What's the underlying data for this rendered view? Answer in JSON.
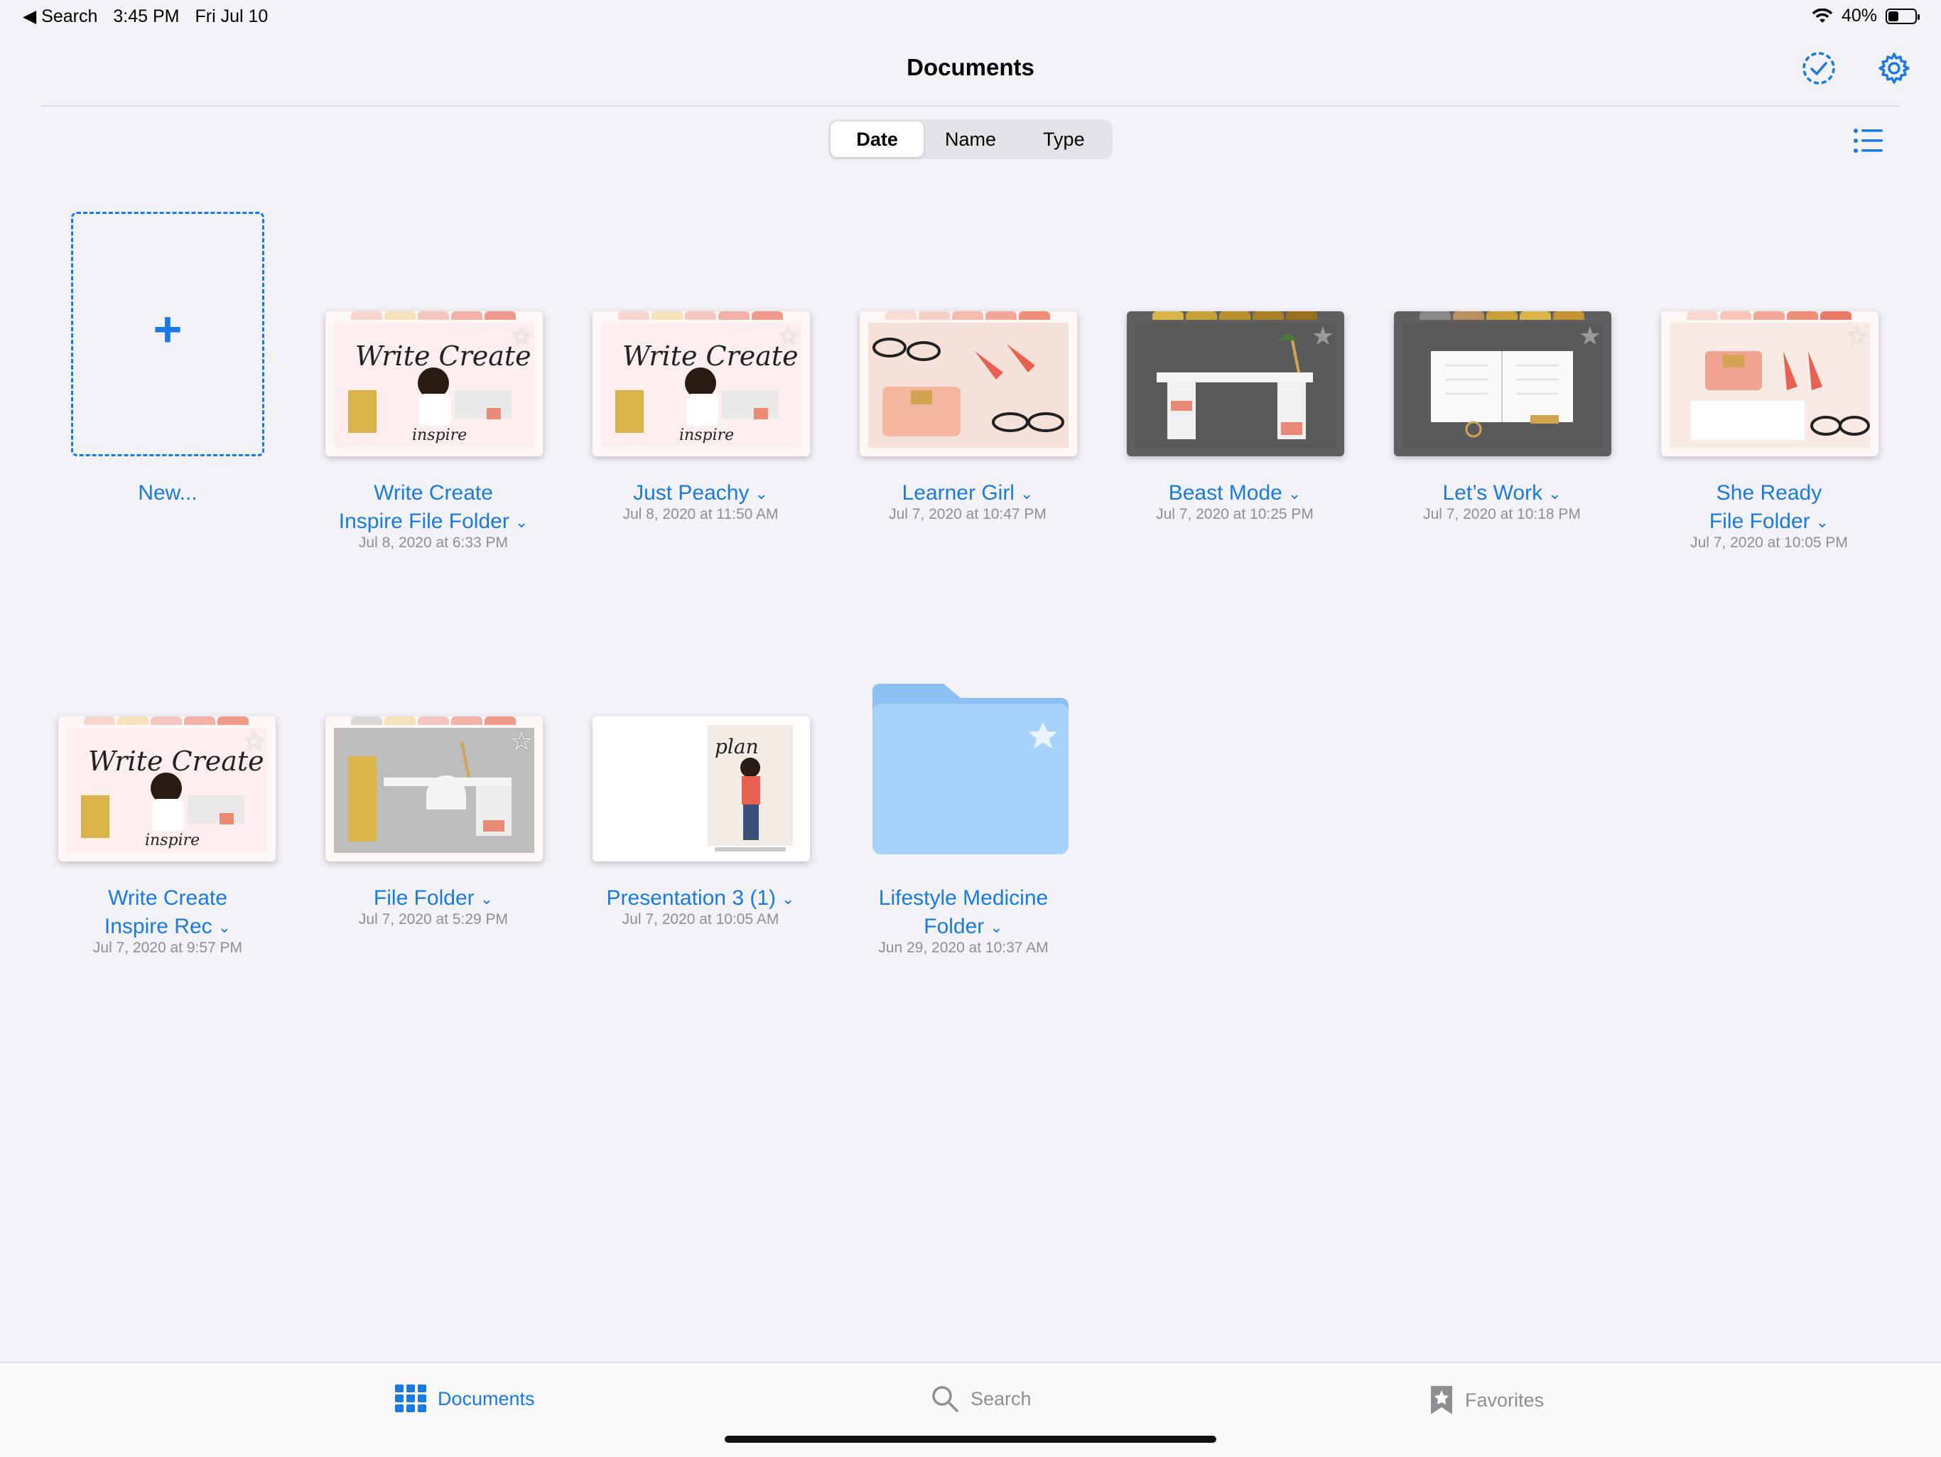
{
  "status": {
    "back_label": "Search",
    "time": "3:45 PM",
    "date": "Fri Jul 10",
    "battery": "40%",
    "battery_level": 0.4
  },
  "header": {
    "title": "Documents"
  },
  "sort": {
    "options": [
      "Date",
      "Name",
      "Type"
    ],
    "selected": "Date"
  },
  "new_item": {
    "label": "New..."
  },
  "documents": [
    {
      "name_lines": [
        "Write Create",
        "Inspire File Folder"
      ],
      "date": "Jul 8, 2020 at 6:33 PM"
    },
    {
      "name_lines": [
        "Just Peachy"
      ],
      "date": "Jul 8, 2020 at 11:50 AM"
    },
    {
      "name_lines": [
        "Learner Girl"
      ],
      "date": "Jul 7, 2020 at 10:47 PM"
    },
    {
      "name_lines": [
        "Beast Mode"
      ],
      "date": "Jul 7, 2020 at 10:25 PM"
    },
    {
      "name_lines": [
        "Let’s Work"
      ],
      "date": "Jul 7, 2020 at 10:18 PM"
    },
    {
      "name_lines": [
        "She Ready",
        "File Folder"
      ],
      "date": "Jul 7, 2020 at 10:05 PM"
    },
    {
      "name_lines": [
        "Write Create",
        "Inspire Rec"
      ],
      "date": "Jul 7, 2020 at 9:57 PM"
    },
    {
      "name_lines": [
        "File Folder"
      ],
      "date": "Jul 7, 2020 at 5:29 PM"
    },
    {
      "name_lines": [
        "Presentation 3 (1)"
      ],
      "date": "Jul 7, 2020 at 10:05 AM"
    },
    {
      "name_lines": [
        "Lifestyle Medicine",
        "Folder"
      ],
      "date": "Jun 29, 2020 at 10:37 AM"
    }
  ],
  "tabbar": {
    "documents": "Documents",
    "search": "Search",
    "favorites": "Favorites"
  },
  "colors": {
    "accent": "#1a7ae2",
    "folder": "#a7d2fa",
    "folder_tab": "#8cc0f2",
    "dark_thumb": "#5a5a5a"
  }
}
